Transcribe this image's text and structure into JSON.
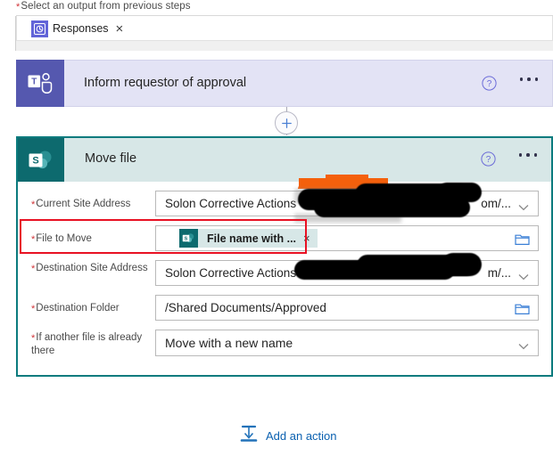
{
  "top": {
    "label": "Select an output from previous steps",
    "required_marker": "*",
    "token": {
      "text": "Responses",
      "icon": "approvals-icon",
      "remove": "×"
    }
  },
  "teams_card": {
    "title": "Inform requestor of approval",
    "icon": "microsoft-teams-icon",
    "help": "?",
    "menu": "…",
    "header_bg": "#e3e3f5",
    "icon_bg": "#5558af"
  },
  "connector": {
    "add_step": "+",
    "arrow": "↓"
  },
  "move_card": {
    "title": "Move file",
    "icon": "sharepoint-icon",
    "help": "?",
    "menu": "…",
    "header_bg": "#d7e7e7",
    "border_color": "#0b7b7e",
    "icon_bg": "#0d6a6e",
    "fields": [
      {
        "label": "Current Site Address",
        "required": "*",
        "value": "Solon Corrective Actions -",
        "value_tail": "om/...",
        "control": "dropdown",
        "redacted": true
      },
      {
        "label": "File to Move",
        "required": "*",
        "token": {
          "text": "File name with ...",
          "icon": "sharepoint-icon",
          "remove": "×"
        },
        "control": "folder-picker",
        "highlighted": true,
        "highlight_color": "#e81123"
      },
      {
        "label": "Destination Site Address",
        "required": "*",
        "value": "Solon Corrective Actions",
        "value_tail": "m/...",
        "control": "dropdown",
        "redacted": true
      },
      {
        "label": "Destination Folder",
        "required": "*",
        "value": "/Shared Documents/Approved",
        "control": "folder-picker"
      },
      {
        "label": "If another file is already there",
        "required": "*",
        "value": "Move with a new name",
        "control": "dropdown"
      }
    ]
  },
  "footer": {
    "add_action_label": "Add an action",
    "icon": "insert-action-icon",
    "color": "#0a60b0"
  }
}
